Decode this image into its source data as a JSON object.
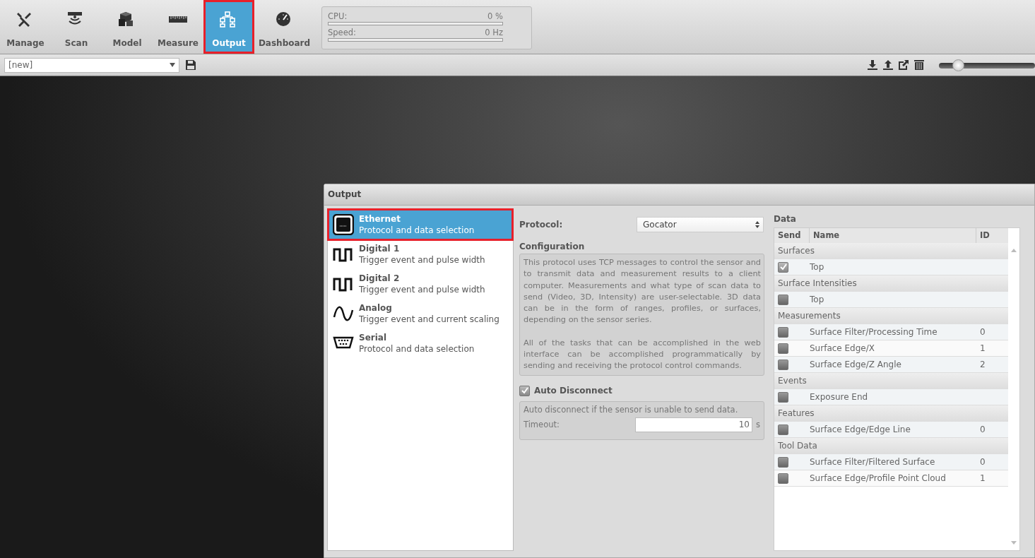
{
  "nav": [
    {
      "label": "Manage",
      "selected": false,
      "highlighted": false
    },
    {
      "label": "Scan",
      "selected": false,
      "highlighted": false
    },
    {
      "label": "Model",
      "selected": false,
      "highlighted": false
    },
    {
      "label": "Measure",
      "selected": false,
      "highlighted": false
    },
    {
      "label": "Output",
      "selected": true,
      "highlighted": true
    },
    {
      "label": "Dashboard",
      "selected": false,
      "highlighted": false
    }
  ],
  "stats": [
    {
      "label": "CPU:",
      "reading": "0 %"
    },
    {
      "label": "Speed:",
      "reading": "0 Hz"
    }
  ],
  "job": {
    "value": "[new]"
  },
  "zoom_slider": {
    "level": 0.2
  },
  "panel": {
    "title": "Output",
    "outputs": [
      {
        "name": "Ethernet",
        "description": "Protocol and data selection",
        "kind": "ethernet",
        "selected": true,
        "highlighted": true
      },
      {
        "name": "Digital 1",
        "description": "Trigger event and pulse width",
        "kind": "digital",
        "selected": false,
        "highlighted": false
      },
      {
        "name": "Digital 2",
        "description": "Trigger event and pulse width",
        "kind": "digital",
        "selected": false,
        "highlighted": false
      },
      {
        "name": "Analog",
        "description": "Trigger event and current scaling",
        "kind": "analog",
        "selected": false,
        "highlighted": false
      },
      {
        "name": "Serial",
        "description": "Protocol and data selection",
        "kind": "serial",
        "selected": false,
        "highlighted": false
      }
    ],
    "protocol": {
      "label": "Protocol:",
      "value": "Gocator"
    },
    "configuration": {
      "title": "Configuration",
      "paragraphs": [
        "This protocol uses TCP messages to control the sensor and to transmit data and measurement results to a client computer. Measurements and what type of scan data to send (Video, 3D, Intensity) are user-selectable. 3D data can be in the form of ranges, profiles, or surfaces, depending on the sensor series.",
        "All of the tasks that can be accomplished in the web interface can be accomplished programmatically by sending and receiving the protocol control commands."
      ]
    },
    "auto_disconnect": {
      "label": "Auto Disconnect",
      "checked": true,
      "description": "Auto disconnect if the sensor is unable to send data.",
      "timeout_label": "Timeout:",
      "timeout_value": "10",
      "unit": "s"
    },
    "data": {
      "title": "Data",
      "columns": [
        "Send",
        "Name",
        "ID"
      ],
      "groups": [
        {
          "name": "Surfaces",
          "rows": [
            {
              "name": "Top",
              "checked": true
            }
          ]
        },
        {
          "name": "Surface Intensities",
          "rows": [
            {
              "name": "Top",
              "checked": false
            }
          ]
        },
        {
          "name": "Measurements",
          "rows": [
            {
              "name": "Surface Filter/Processing Time",
              "id": "0",
              "checked": false
            },
            {
              "name": "Surface Edge/X",
              "id": "1",
              "checked": false
            },
            {
              "name": "Surface Edge/Z Angle",
              "id": "2",
              "checked": false
            }
          ]
        },
        {
          "name": "Events",
          "rows": [
            {
              "name": "Exposure End",
              "checked": false
            }
          ]
        },
        {
          "name": "Features",
          "rows": [
            {
              "name": "Surface Edge/Edge Line",
              "id": "0",
              "checked": false
            }
          ]
        },
        {
          "name": "Tool Data",
          "rows": [
            {
              "name": "Surface Filter/Filtered Surface",
              "id": "0",
              "checked": false
            },
            {
              "name": "Surface Edge/Profile Point Cloud",
              "id": "1",
              "checked": false
            }
          ]
        }
      ]
    }
  }
}
